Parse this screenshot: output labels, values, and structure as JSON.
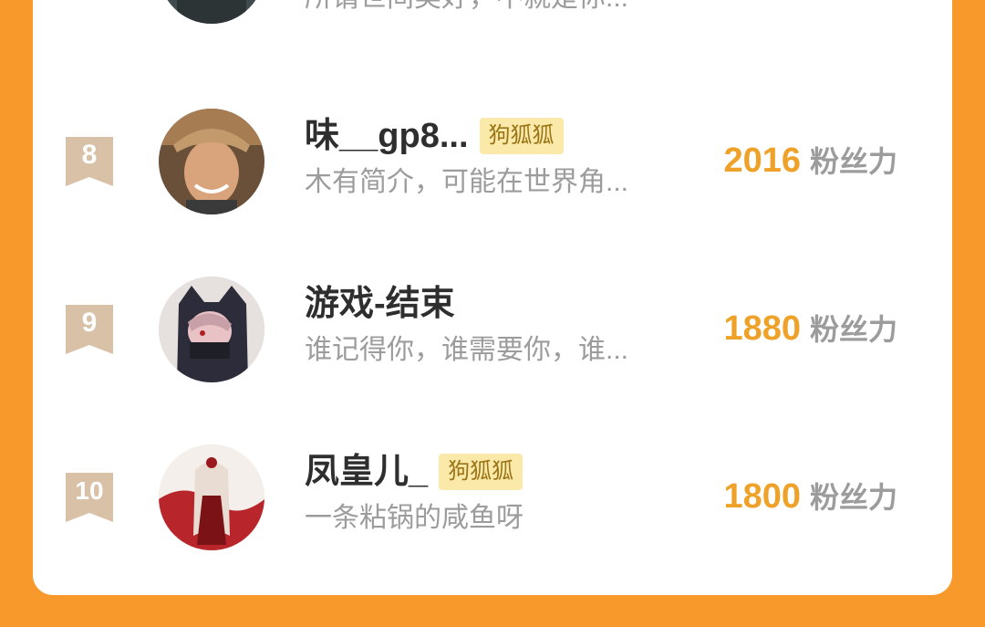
{
  "list": {
    "top_partial": {
      "bio": "所谓世间美好，不就是你..."
    },
    "rows": [
      {
        "rank": "8",
        "name": "味__gp8...",
        "badge": "狗狐狐",
        "bio": "木有简介，可能在世界角...",
        "score": "2016",
        "unit": "粉丝力"
      },
      {
        "rank": "9",
        "name": "游戏-结束",
        "badge": "",
        "bio": "谁记得你，谁需要你，谁...",
        "score": "1880",
        "unit": "粉丝力"
      },
      {
        "rank": "10",
        "name": "凤皇儿_",
        "badge": "狗狐狐",
        "bio": "一条粘锅的咸鱼呀",
        "score": "1800",
        "unit": "粉丝力"
      }
    ]
  },
  "colors": {
    "background": "#f79a2b",
    "score": "#efa229",
    "badge_bg": "#fbe9a9",
    "rank_ribbon": "#d9c1a8"
  }
}
